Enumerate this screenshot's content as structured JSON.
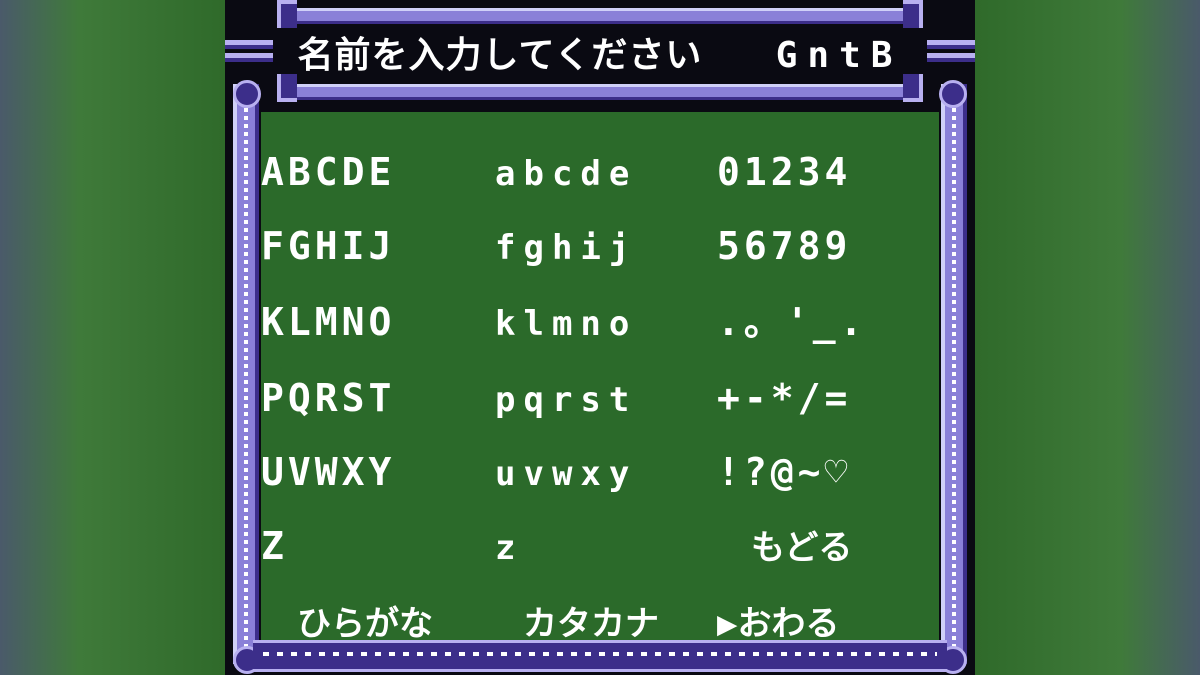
{
  "header": {
    "prompt": "名前を入力してください",
    "current_name": "GntB"
  },
  "keyboard": {
    "uppercase": [
      "ABCDE",
      "FGHIJ",
      "KLMNO",
      "PQRST",
      "UVWXY",
      "Z"
    ],
    "lowercase": [
      "abcde",
      "fghij",
      "klmno",
      "pqrst",
      "uvwxy",
      "z"
    ],
    "symbols": [
      "01234",
      "56789",
      ".。'_.",
      "+-*/=",
      "!?@~♡"
    ]
  },
  "menu": {
    "back": "もどる",
    "hiragana": "ひらがな",
    "katakana": "カタカナ",
    "cursor": "▶",
    "finish": "おわる"
  },
  "colors": {
    "panel_green": "#2b6a2a",
    "frame_purple": "#8a80d8",
    "frame_dark": "#3c2e8a",
    "text": "#ffffff"
  }
}
